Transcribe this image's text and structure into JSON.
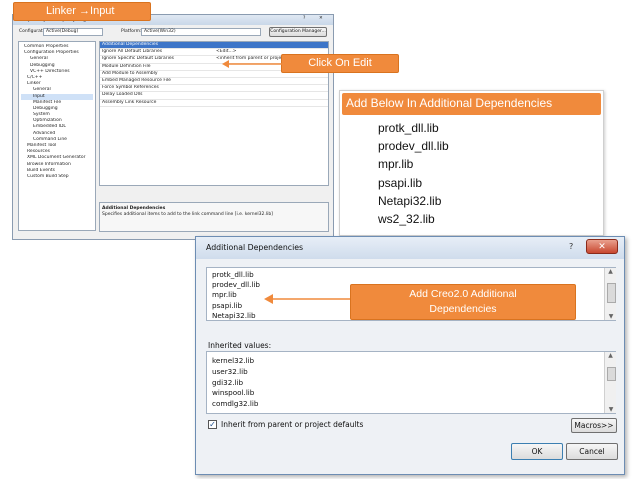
{
  "callouts": {
    "linker_input": "Linker →Input",
    "click_on_edit": "Click On Edit",
    "add_below_header": "Add Below In Additional Dependencies",
    "add_creo": "Add Creo2.0 Additional Dependencies"
  },
  "libs_to_add": [
    "protk_dll.lib",
    "prodev_dll.lib",
    "mpr.lib",
    "psapi.lib",
    "Netapi32.lib",
    "ws2_32.lib"
  ],
  "property_pages": {
    "title": "SampleProject Property Pages",
    "configuration_label": "Configuration:",
    "configuration_value": "Active(Debug)",
    "platform_label": "Platform:",
    "platform_value": "Active(Win32)",
    "config_manager": "Configuration Manager...",
    "tree": [
      "Common Properties",
      "Configuration Properties",
      "General",
      "Debugging",
      "VC++ Directories",
      "C/C++",
      "Linker",
      "General",
      "Input",
      "Manifest File",
      "Debugging",
      "System",
      "Optimization",
      "Embedded IDL",
      "Advanced",
      "Command Line",
      "Manifest Tool",
      "Resources",
      "XML Document Generator",
      "Browse Information",
      "Build Events",
      "Custom Build Step"
    ],
    "grid_rows": [
      {
        "name": "Additional Dependencies",
        "value": ""
      },
      {
        "name": "Ignore All Default Libraries",
        "value": "<Edit...>"
      },
      {
        "name": "Ignore Specific Default Libraries",
        "value": "<inherit from parent or project defaults>"
      },
      {
        "name": "Module Definition File",
        "value": ""
      },
      {
        "name": "Add Module to Assembly",
        "value": ""
      },
      {
        "name": "Embed Managed Resource File",
        "value": ""
      },
      {
        "name": "Force Symbol References",
        "value": ""
      },
      {
        "name": "Delay Loaded Dlls",
        "value": ""
      },
      {
        "name": "Assembly Link Resource",
        "value": ""
      }
    ],
    "desc_title": "Additional Dependencies",
    "desc_text": "Specifies additional items to add to the link command line [i.e. kernel32.lib]"
  },
  "dialog": {
    "title": "Additional Dependencies",
    "items": [
      "protk_dll.lib",
      "prodev_dll.lib",
      "mpr.lib",
      "psapi.lib",
      "Netapi32.lib"
    ],
    "inherited_label": "Inherited values:",
    "inherited": [
      "kernel32.lib",
      "user32.lib",
      "gdi32.lib",
      "winspool.lib",
      "comdlg32.lib"
    ],
    "inherit_checkbox": "Inherit from parent or project defaults",
    "macros_button": "Macros>>",
    "ok_button": "OK",
    "cancel_button": "Cancel",
    "help_glyph": "?"
  },
  "colors": {
    "callout_orange": "#f08a3c",
    "arrow_orange": "#f08a3c"
  }
}
